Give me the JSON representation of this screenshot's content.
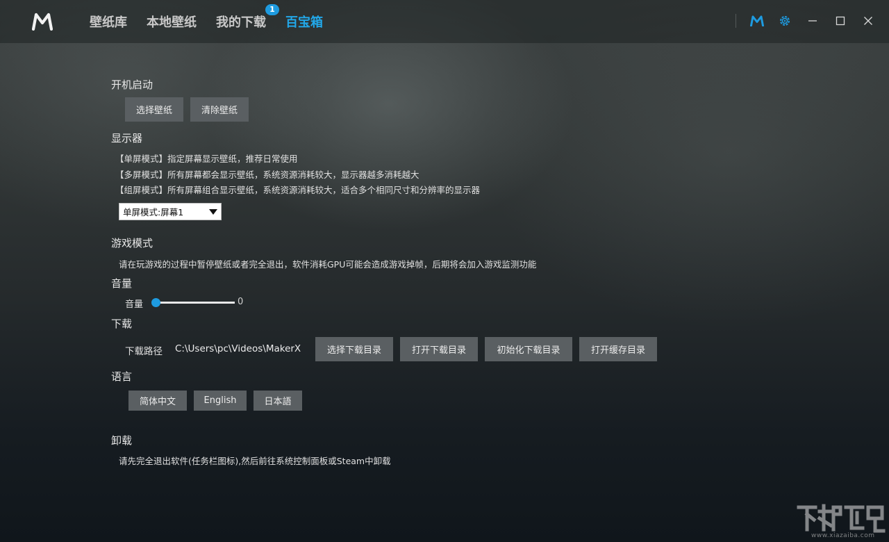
{
  "nav": {
    "items": [
      {
        "label": "壁纸库"
      },
      {
        "label": "本地壁纸"
      },
      {
        "label": "我的下载",
        "badge": "1"
      },
      {
        "label": "百宝箱",
        "active": true
      }
    ]
  },
  "colors": {
    "accent": "#22a7e8",
    "badge": "#1e9be0",
    "button_bg": "#5a5f62"
  },
  "icons": {
    "app_logo": "m-logo-icon",
    "brand": "m-brand-icon",
    "settings": "gear-icon",
    "minimize": "minimize-icon",
    "maximize": "maximize-icon",
    "close": "close-icon"
  },
  "startup": {
    "title": "开机启动",
    "select_button": "选择壁纸",
    "clear_button": "清除壁纸"
  },
  "display": {
    "title": "显示器",
    "modes": [
      "【单屏模式】指定屏幕显示壁纸，推荐日常使用",
      "【多屏模式】所有屏幕都会显示壁纸，系统资源消耗较大，显示器越多消耗越大",
      "【组屏模式】所有屏幕组合显示壁纸，系统资源消耗较大，适合多个相同尺寸和分辨率的显示器"
    ],
    "selected_mode": "单屏模式:屏幕1"
  },
  "game_mode": {
    "title": "游戏模式",
    "description": "请在玩游戏的过程中暂停壁纸或者完全退出，软件消耗GPU可能会造成游戏掉帧，后期将会加入游戏监测功能"
  },
  "volume": {
    "title": "音量",
    "label": "音量",
    "value": 0,
    "value_text": "0"
  },
  "download": {
    "title": "下载",
    "path_label": "下载路径",
    "path_value": "C:\\Users\\pc\\Videos\\MakerX",
    "buttons": [
      "选择下载目录",
      "打开下载目录",
      "初始化下载目录",
      "打开缓存目录"
    ]
  },
  "language": {
    "title": "语言",
    "options": [
      "简体中文",
      "English",
      "日本語"
    ]
  },
  "uninstall": {
    "title": "卸载",
    "description": "请先完全退出软件(任务栏图标),然后前往系统控制面板或Steam中卸载"
  },
  "watermark": {
    "text": "www.xiazaiba.com"
  }
}
